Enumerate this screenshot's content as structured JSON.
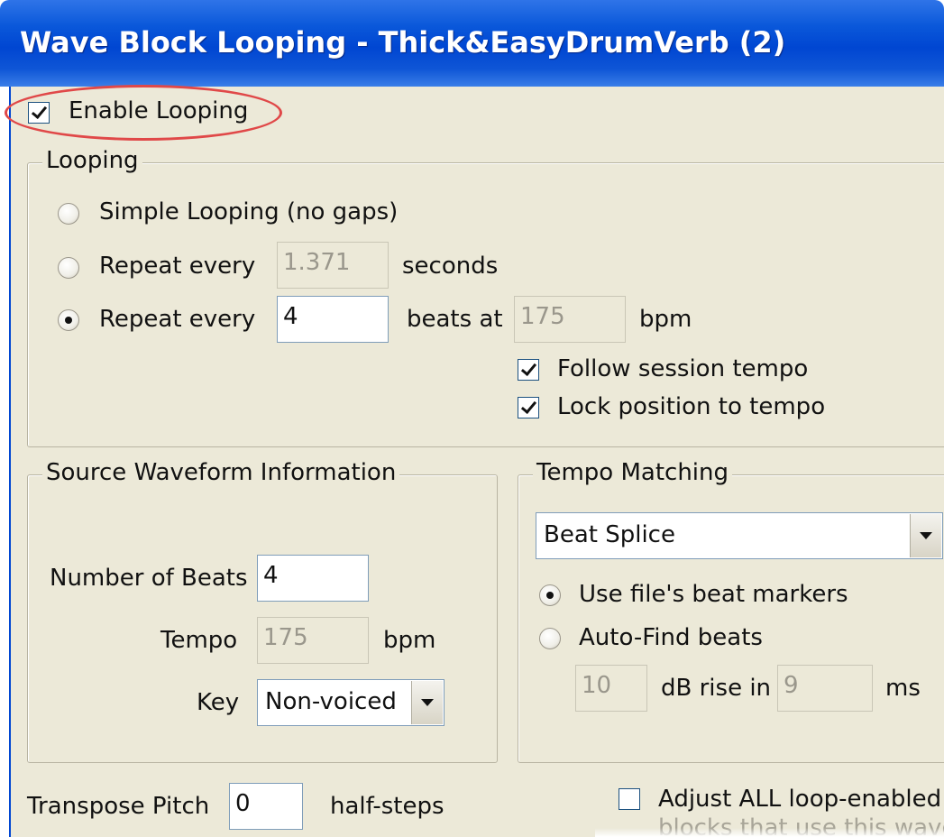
{
  "window": {
    "title": "Wave Block Looping - Thick&EasyDrumVerb (2)"
  },
  "enable_looping": {
    "label": "Enable Looping",
    "checked": true
  },
  "looping": {
    "group_label": "Looping",
    "simple": {
      "label": "Simple Looping (no gaps)",
      "selected": false
    },
    "repeat_seconds": {
      "label": "Repeat every",
      "value": "1.371",
      "unit": "seconds",
      "selected": false
    },
    "repeat_beats": {
      "label": "Repeat every",
      "value": "4",
      "beats_label": "beats at",
      "bpm_value": "175",
      "bpm_unit": "bpm",
      "selected": true
    },
    "follow_tempo": {
      "label": "Follow session tempo",
      "checked": true
    },
    "lock_position": {
      "label": "Lock position to tempo",
      "checked": true
    }
  },
  "source": {
    "group_label": "Source Waveform Information",
    "beats_label": "Number of Beats",
    "beats_value": "4",
    "tempo_label": "Tempo",
    "tempo_value": "175",
    "tempo_unit": "bpm",
    "key_label": "Key",
    "key_value": "Non-voiced"
  },
  "tempo_matching": {
    "group_label": "Tempo Matching",
    "mode": "Beat Splice",
    "use_markers": {
      "label": "Use file's beat markers",
      "selected": true
    },
    "auto_find": {
      "label": "Auto-Find beats",
      "selected": false
    },
    "db_value": "10",
    "db_label": "dB rise in",
    "ms_value": "9",
    "ms_label": "ms"
  },
  "transpose": {
    "label": "Transpose Pitch",
    "value": "0",
    "unit": "half-steps"
  },
  "adjust_all": {
    "label": "Adjust ALL loop-enabled",
    "label2": "blocks that use this wave",
    "checked": false
  },
  "colors": {
    "titlebar": "#0046d2",
    "dialog_bg": "#ece9d8",
    "highlight_ring": "#e04848"
  }
}
